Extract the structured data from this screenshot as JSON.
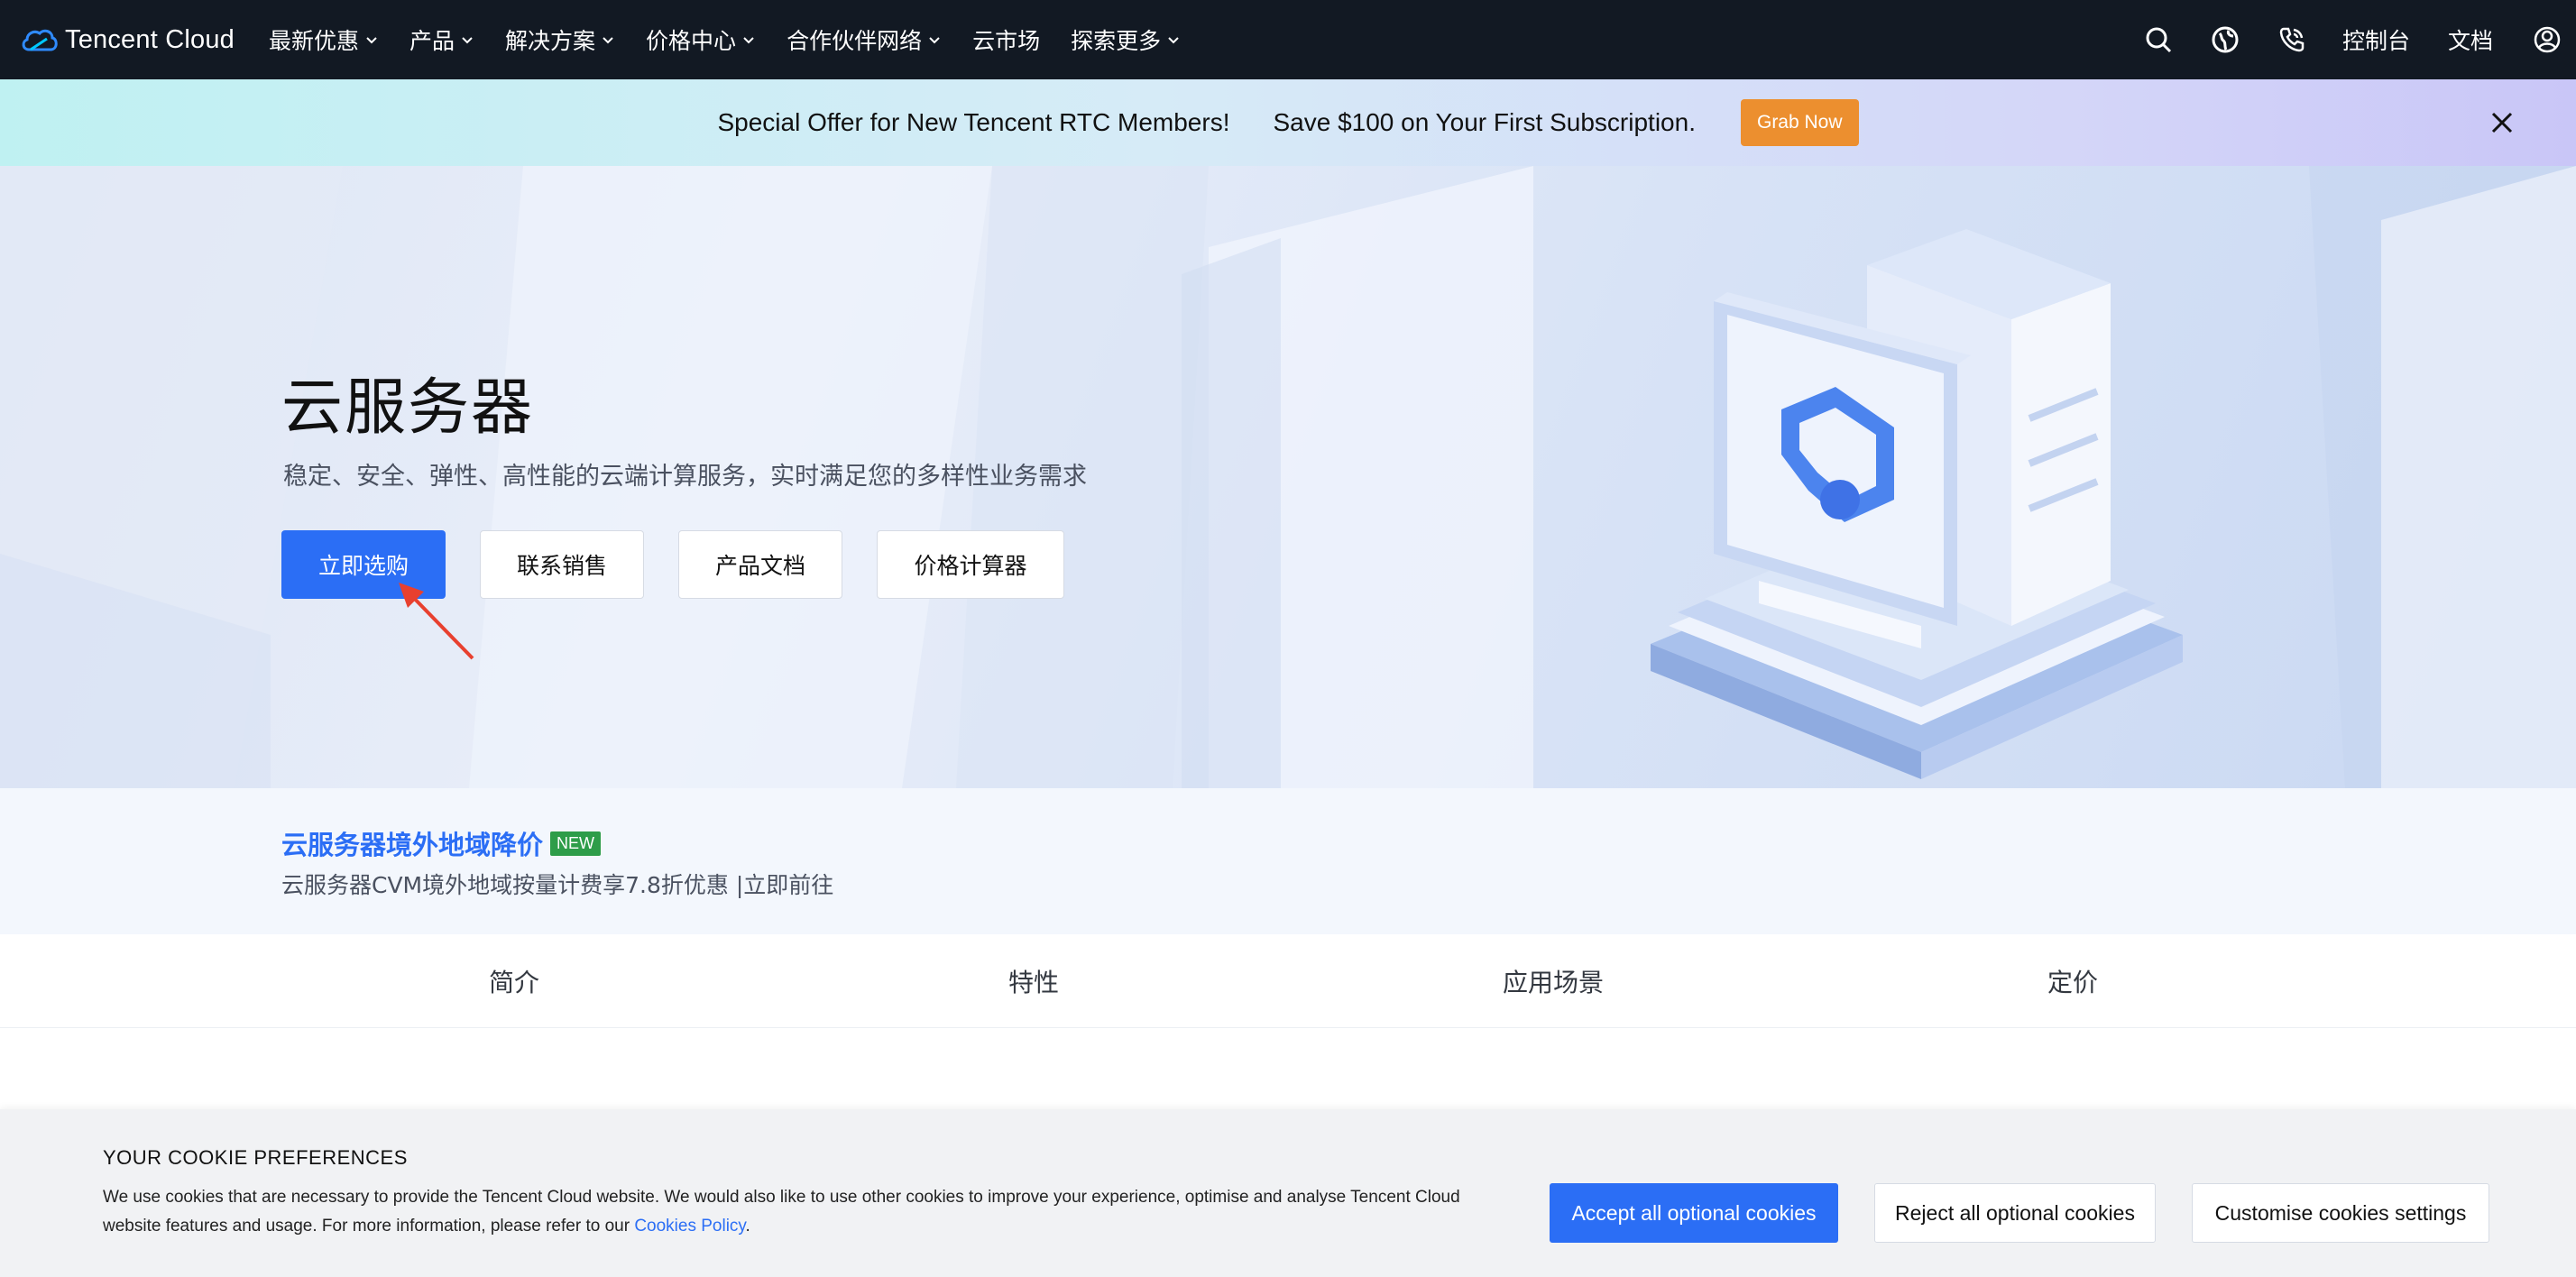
{
  "nav": {
    "logo_text": "Tencent Cloud",
    "menu": [
      {
        "label": "最新优惠",
        "has_dropdown": true
      },
      {
        "label": "产品",
        "has_dropdown": true
      },
      {
        "label": "解决方案",
        "has_dropdown": true
      },
      {
        "label": "价格中心",
        "has_dropdown": true
      },
      {
        "label": "合作伙伴网络",
        "has_dropdown": true
      },
      {
        "label": "云市场",
        "has_dropdown": false
      },
      {
        "label": "探索更多",
        "has_dropdown": true
      }
    ],
    "right": {
      "icons": [
        "search-icon",
        "globe-icon",
        "phone-icon"
      ],
      "console_label": "控制台",
      "docs_label": "文档",
      "menu_icon": "user-menu-icon"
    }
  },
  "promo": {
    "text1": "Special Offer for New Tencent RTC Members!",
    "text2": "Save $100 on Your First Subscription.",
    "button_label": "Grab Now",
    "button_color": "#ec8f2f",
    "close_icon": "close-icon"
  },
  "hero": {
    "title": "云服务器",
    "subtitle": "稳定、安全、弹性、高性能的云端计算服务，实时满足您的多样性业务需求",
    "buttons": {
      "buy": "立即选购",
      "contact": "联系销售",
      "docs": "产品文档",
      "calculator": "价格计算器"
    },
    "accent": "#2b6ef5"
  },
  "notice": {
    "title": "云服务器境外地域降价",
    "badge": "NEW",
    "badge_color": "#2e9d49",
    "desc": "云服务器CVM境外地域按量计费享7.8折优惠 |立即前往"
  },
  "tabs": [
    {
      "label": "简介"
    },
    {
      "label": "特性"
    },
    {
      "label": "应用场景"
    },
    {
      "label": "定价"
    }
  ],
  "cookie": {
    "title": "YOUR COOKIE PREFERENCES",
    "text": "We use cookies that are necessary to provide the Tencent Cloud website. We would also like to use other cookies to improve your experience, optimise and analyse Tencent Cloud website features and usage. For more information, please refer to our ",
    "link_label": "Cookies Policy",
    "text_end": ".",
    "accept_label": "Accept all optional cookies",
    "reject_label": "Reject all optional cookies",
    "customise_label": "Customise cookies settings"
  }
}
